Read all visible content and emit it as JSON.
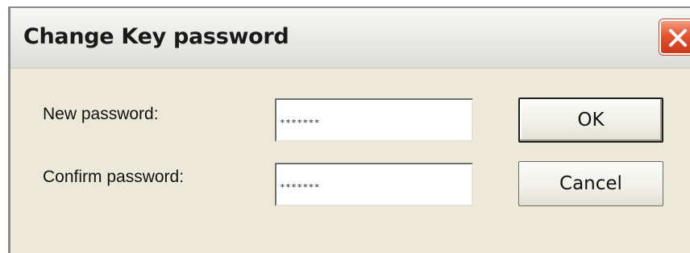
{
  "window": {
    "title": "Change Key password",
    "close_icon": "close-icon"
  },
  "form": {
    "new_password_label": "New password:",
    "new_password_value": "*******",
    "confirm_password_label": "Confirm password:",
    "confirm_password_value": "*******"
  },
  "buttons": {
    "ok_label": "OK",
    "cancel_label": "Cancel"
  },
  "colors": {
    "dialog_bg": "#ece9d8",
    "close_button": "#e2562f"
  }
}
